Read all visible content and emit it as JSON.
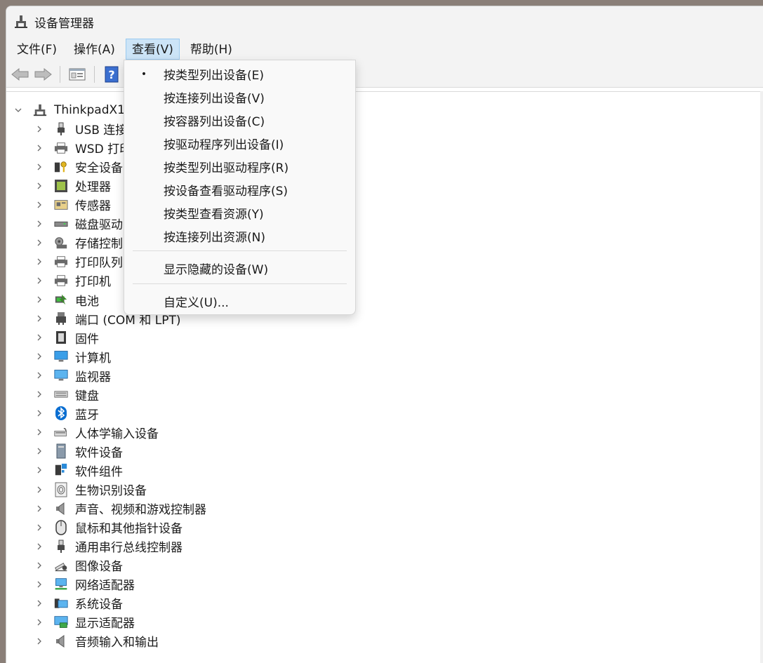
{
  "window": {
    "title": "设备管理器"
  },
  "menubar": {
    "items": [
      "文件(F)",
      "操作(A)",
      "查看(V)",
      "帮助(H)"
    ],
    "active_index": 2
  },
  "toolbar": {
    "buttons": [
      "back-icon",
      "forward-icon",
      "properties-icon",
      "help-icon"
    ]
  },
  "tree": {
    "root": "ThinkpadX1y",
    "items": [
      {
        "label": "USB 连接",
        "icon": "usb-icon"
      },
      {
        "label": "WSD 打印",
        "icon": "printer-icon"
      },
      {
        "label": "安全设备",
        "icon": "security-key-icon"
      },
      {
        "label": "处理器",
        "icon": "cpu-icon"
      },
      {
        "label": "传感器",
        "icon": "sensor-icon"
      },
      {
        "label": "磁盘驱动",
        "icon": "disk-icon"
      },
      {
        "label": "存储控制",
        "icon": "storage-controller-icon"
      },
      {
        "label": "打印队列",
        "icon": "printer-icon"
      },
      {
        "label": "打印机",
        "icon": "printer-icon"
      },
      {
        "label": "电池",
        "icon": "battery-icon"
      },
      {
        "label": "端口 (COM 和 LPT)",
        "icon": "port-icon"
      },
      {
        "label": "固件",
        "icon": "firmware-icon"
      },
      {
        "label": "计算机",
        "icon": "computer-icon"
      },
      {
        "label": "监视器",
        "icon": "monitor-icon"
      },
      {
        "label": "键盘",
        "icon": "keyboard-icon"
      },
      {
        "label": "蓝牙",
        "icon": "bluetooth-icon"
      },
      {
        "label": "人体学输入设备",
        "icon": "hid-icon"
      },
      {
        "label": "软件设备",
        "icon": "software-device-icon"
      },
      {
        "label": "软件组件",
        "icon": "software-component-icon"
      },
      {
        "label": "生物识别设备",
        "icon": "fingerprint-icon"
      },
      {
        "label": "声音、视频和游戏控制器",
        "icon": "speaker-icon"
      },
      {
        "label": "鼠标和其他指针设备",
        "icon": "mouse-icon"
      },
      {
        "label": "通用串行总线控制器",
        "icon": "usb-icon"
      },
      {
        "label": "图像设备",
        "icon": "camera-icon"
      },
      {
        "label": "网络适配器",
        "icon": "network-icon"
      },
      {
        "label": "系统设备",
        "icon": "system-icon"
      },
      {
        "label": "显示适配器",
        "icon": "display-adapter-icon"
      },
      {
        "label": "音频输入和输出",
        "icon": "speaker-icon"
      }
    ]
  },
  "view_menu": {
    "items": [
      {
        "label": "按类型列出设备(E)",
        "checked": true
      },
      {
        "label": "按连接列出设备(V)",
        "checked": false
      },
      {
        "label": "按容器列出设备(C)",
        "checked": false
      },
      {
        "label": "按驱动程序列出设备(I)",
        "checked": false
      },
      {
        "label": "按类型列出驱动程序(R)",
        "checked": false
      },
      {
        "label": "按设备查看驱动程序(S)",
        "checked": false
      },
      {
        "label": "按类型查看资源(Y)",
        "checked": false
      },
      {
        "label": "按连接列出资源(N)",
        "checked": false
      }
    ],
    "hidden_devices": "显示隐藏的设备(W)",
    "customize": "自定义(U)...",
    "bullet": "•"
  },
  "colors": {
    "menu_active_bg": "#cce4f7",
    "accent": "#0067c0"
  }
}
